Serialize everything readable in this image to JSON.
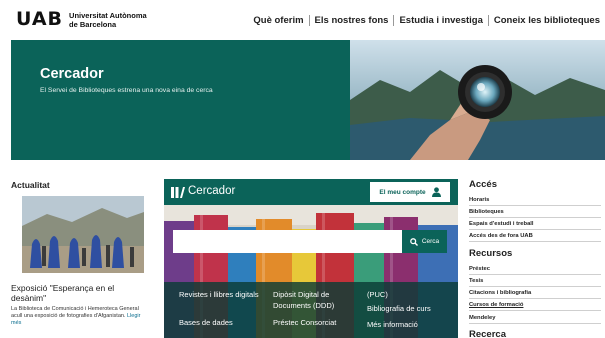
{
  "header": {
    "logo_mark": "UAB",
    "logo_line1": "Universitat Autònoma",
    "logo_line2": "de Barcelona",
    "nav": [
      "Què oferim",
      "Els nostres fons",
      "Estudia i investiga",
      "Coneix les biblioteques"
    ]
  },
  "hero": {
    "title": "Cercador",
    "subtitle": "El Servei de Biblioteques estrena una nova eina de cerca"
  },
  "news": {
    "section_title": "Actualitat",
    "title": "Exposició \"Esperança en el desànim\"",
    "text": "La Biblioteca de Comunicació i Hemeroteca General acull una exposició de fotografies d'Afganistan.",
    "more": "Llegir més"
  },
  "cercador": {
    "title": "Cercador",
    "account_label": "El meu compte",
    "search_placeholder": "",
    "search_button": "Cerca",
    "links": {
      "revistes": "Revistes i llibres digitals",
      "bases": "Bases de dades",
      "diposit": "Dipòsit Digital de Documents (DDD)",
      "prestec_cons": "Préstec Consorciat",
      "puc": "(PUC)",
      "bibliografia": "Bibliografia de curs",
      "mes_info": "Més informació"
    }
  },
  "acces": {
    "title": "Accés",
    "items": [
      "Horaris",
      "Biblioteques",
      "Espais d'estudi i treball",
      "Accés des de fora UAB"
    ]
  },
  "recursos": {
    "title": "Recursos",
    "items": [
      "Préstec",
      "Tesis",
      "Citacions i bibliografia",
      "Cursos de formació",
      "Mendeley"
    ]
  },
  "recerca": {
    "title": "Recerca"
  },
  "colors": {
    "brand_green": "#0b6359",
    "link_blue": "#0b6e8f"
  }
}
